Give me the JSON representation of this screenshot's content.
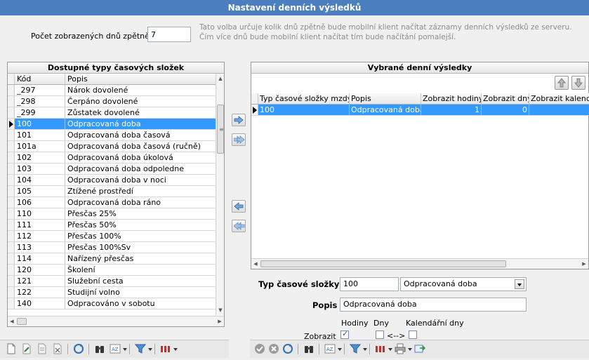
{
  "window": {
    "title": "Nastavení denních výsledků"
  },
  "settings": {
    "days_label": "Počet zobrazených dnů zpětně",
    "days_value": "7",
    "days_hint": "Tato volba určuje kolik dnů zpětně bude mobilní klient načítat záznamy denních výsledků ze serveru. Čím více dnů bude mobilní klient načítat tím bude načítání pomalejší."
  },
  "available": {
    "title": "Dostupné typy časových složek",
    "columns": {
      "code": "Kód",
      "desc": "Popis"
    },
    "rows": [
      {
        "code": "_297",
        "desc": "Nárok dovolené"
      },
      {
        "code": "_298",
        "desc": "Čerpáno dovolené"
      },
      {
        "code": "_299",
        "desc": "Zůstatek dovolené"
      },
      {
        "code": "100",
        "desc": "Odpracovaná doba"
      },
      {
        "code": "101",
        "desc": "Odpracovaná doba časová"
      },
      {
        "code": "101a",
        "desc": "Odpracovaná doba časová (ručně)"
      },
      {
        "code": "102",
        "desc": "Odpracovaná doba úkolová"
      },
      {
        "code": "103",
        "desc": "Odpracovaná doba odpoledne"
      },
      {
        "code": "104",
        "desc": "Odpracovaná doba v noci"
      },
      {
        "code": "105",
        "desc": "Ztížené prostředí"
      },
      {
        "code": "106",
        "desc": "Odpracovaná doba ráno"
      },
      {
        "code": "110",
        "desc": "Přesčas 25%"
      },
      {
        "code": "111",
        "desc": "Přesčas 50%"
      },
      {
        "code": "112",
        "desc": "Přesčas 100%"
      },
      {
        "code": "113",
        "desc": "Přesčas 100%Sv"
      },
      {
        "code": "114",
        "desc": "Nařízený přesčas"
      },
      {
        "code": "120",
        "desc": "Školení"
      },
      {
        "code": "121",
        "desc": "Služební cesta"
      },
      {
        "code": "122",
        "desc": "Studijní volno"
      },
      {
        "code": "140",
        "desc": "Odpracováno v sobotu"
      }
    ],
    "selected_index": 3
  },
  "selected_results": {
    "title": "Vybrané denní výsledky",
    "columns": {
      "type": "Typ časové složky mzdy",
      "desc": "Popis",
      "hours": "Zobrazit hodiny",
      "days": "Zobrazit dny",
      "cal": "Zobrazit kalendá"
    },
    "rows": [
      {
        "type": "100",
        "desc": "Odpracovaná doba",
        "hours": "1",
        "days": "0",
        "cal": ""
      }
    ]
  },
  "detail": {
    "type_label": "Typ časové složky",
    "type_value": "100",
    "type_combo": "Odpracovaná doba",
    "desc_label": "Popis",
    "desc_value": "Odpracovaná doba",
    "col_hours": "Hodiny",
    "col_days": "Dny",
    "col_cal": "Kalendářní dny",
    "show_label": "Zobrazit",
    "swap_label": "<-->",
    "hours_checked": true,
    "days_checked": false,
    "cal_checked": false
  },
  "icons": {
    "move_up": "arrow-up-icon",
    "move_down": "arrow-down-icon",
    "add": "arrow-right-icon",
    "add_all": "double-arrow-right-icon",
    "remove": "arrow-left-icon",
    "remove_all": "double-arrow-left-icon"
  },
  "colors": {
    "title_bar": "#4c7fc0",
    "selection": "#3399ff"
  }
}
